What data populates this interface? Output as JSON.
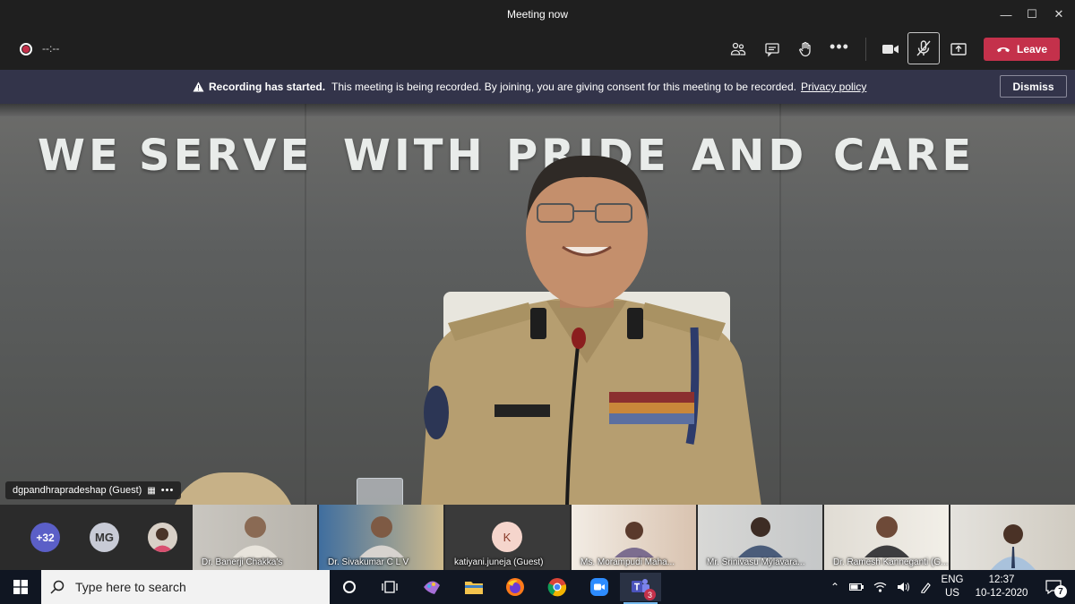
{
  "window": {
    "title": "Meeting now"
  },
  "toolbar": {
    "timer": "--:--",
    "leave_label": "Leave",
    "buttons": [
      "participants-icon",
      "chat-icon",
      "raise-hand-icon",
      "more-icon",
      "camera-icon",
      "mic-muted-icon",
      "share-screen-icon"
    ]
  },
  "banner": {
    "title": "Recording has started.",
    "message": "This meeting is being recorded. By joining, you are giving consent for this meeting to be recorded.",
    "link": "Privacy policy",
    "dismiss_label": "Dismiss"
  },
  "stage": {
    "slogan_words": [
      "WE",
      "SERVE",
      "WITH",
      "PRIDE",
      "AND",
      "CARE"
    ],
    "speaker_name": "dgpandhrapradeshap (Guest)"
  },
  "participants": {
    "overflow_count": "+32",
    "avatar_initials": "MG",
    "tiles": [
      {
        "name": "Dr. Banerji Chakka's"
      },
      {
        "name": "Dr. Sivakumar C L V"
      },
      {
        "name": "katiyani.juneja (Guest)",
        "initial": "K"
      },
      {
        "name": "Ms. Morampudi Maha..."
      },
      {
        "name": "Mr. Srinivasu Mylavara..."
      },
      {
        "name": "Dr. Ramesh Kanneganti (G..."
      },
      {
        "name": ""
      }
    ]
  },
  "taskbar": {
    "search_placeholder": "Type here to search",
    "teams_badge": "3",
    "lang_line1": "ENG",
    "lang_line2": "US",
    "time": "12:37",
    "date": "10-12-2020",
    "notification_count": "7"
  },
  "colors": {
    "leave": "#c4314b",
    "banner": "#33344a",
    "taskbar": "#101622",
    "overflow_avatar": "#5b5fc7"
  }
}
